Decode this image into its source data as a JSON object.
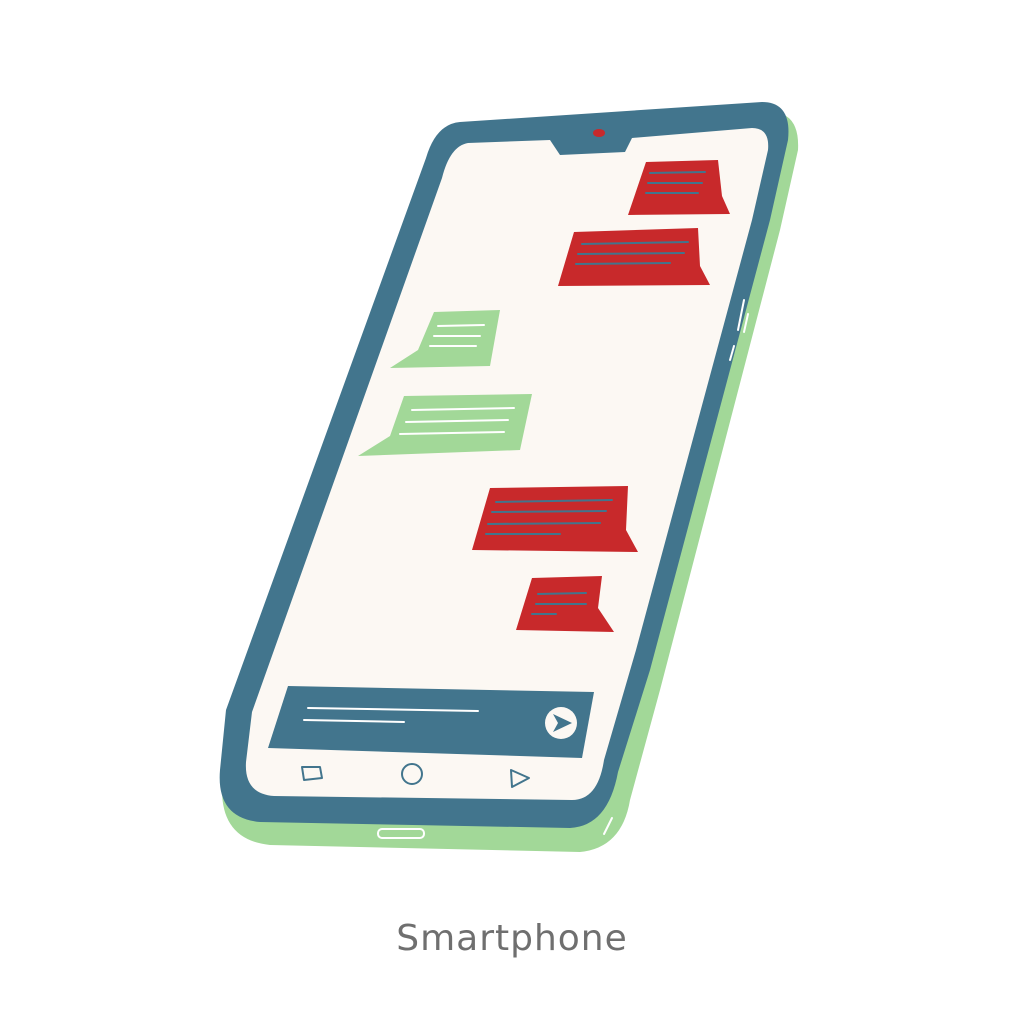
{
  "caption": "Smartphone",
  "colors": {
    "background": "#ffffff",
    "phone_frame": "#42758d",
    "phone_shadow": "#a2d898",
    "screen": "#fcf8f3",
    "sent_bubble": "#c8292b",
    "received_bubble": "#a2d898",
    "camera_dot": "#c8292b",
    "caption_text": "#6f6f6f"
  },
  "icons": {
    "send": "send-arrow-icon",
    "nav_back": "nav-square-icon",
    "nav_home": "nav-circle-icon",
    "nav_recent": "nav-triangle-icon"
  },
  "messages": [
    {
      "side": "sent"
    },
    {
      "side": "sent"
    },
    {
      "side": "received"
    },
    {
      "side": "received"
    },
    {
      "side": "sent"
    },
    {
      "side": "sent"
    }
  ]
}
